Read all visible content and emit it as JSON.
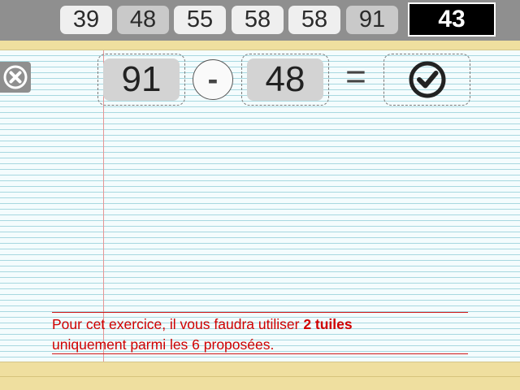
{
  "tiles": [
    {
      "value": "39",
      "used": false
    },
    {
      "value": "48",
      "used": true
    },
    {
      "value": "55",
      "used": false
    },
    {
      "value": "58",
      "used": false
    },
    {
      "value": "58",
      "used": false
    },
    {
      "value": "91",
      "used": true
    }
  ],
  "target": "43",
  "equation": {
    "operand1": "91",
    "operator": "-",
    "operand2": "48",
    "equals": "=",
    "result_icon": "check-circle-icon"
  },
  "close_icon": "close-circle-icon",
  "instructions": {
    "line1_prefix": "Pour cet exercice, il vous faudra utiliser ",
    "line1_bold": "2 tuiles",
    "line2": "uniquement parmi les 6 proposées."
  },
  "colors": {
    "topbar": "#8f8f8f",
    "tile": "#efefef",
    "tile_used": "#c9c9c9",
    "target_bg": "#000000",
    "paper_band": "#efdf9f",
    "instruction_text": "#d00000"
  }
}
